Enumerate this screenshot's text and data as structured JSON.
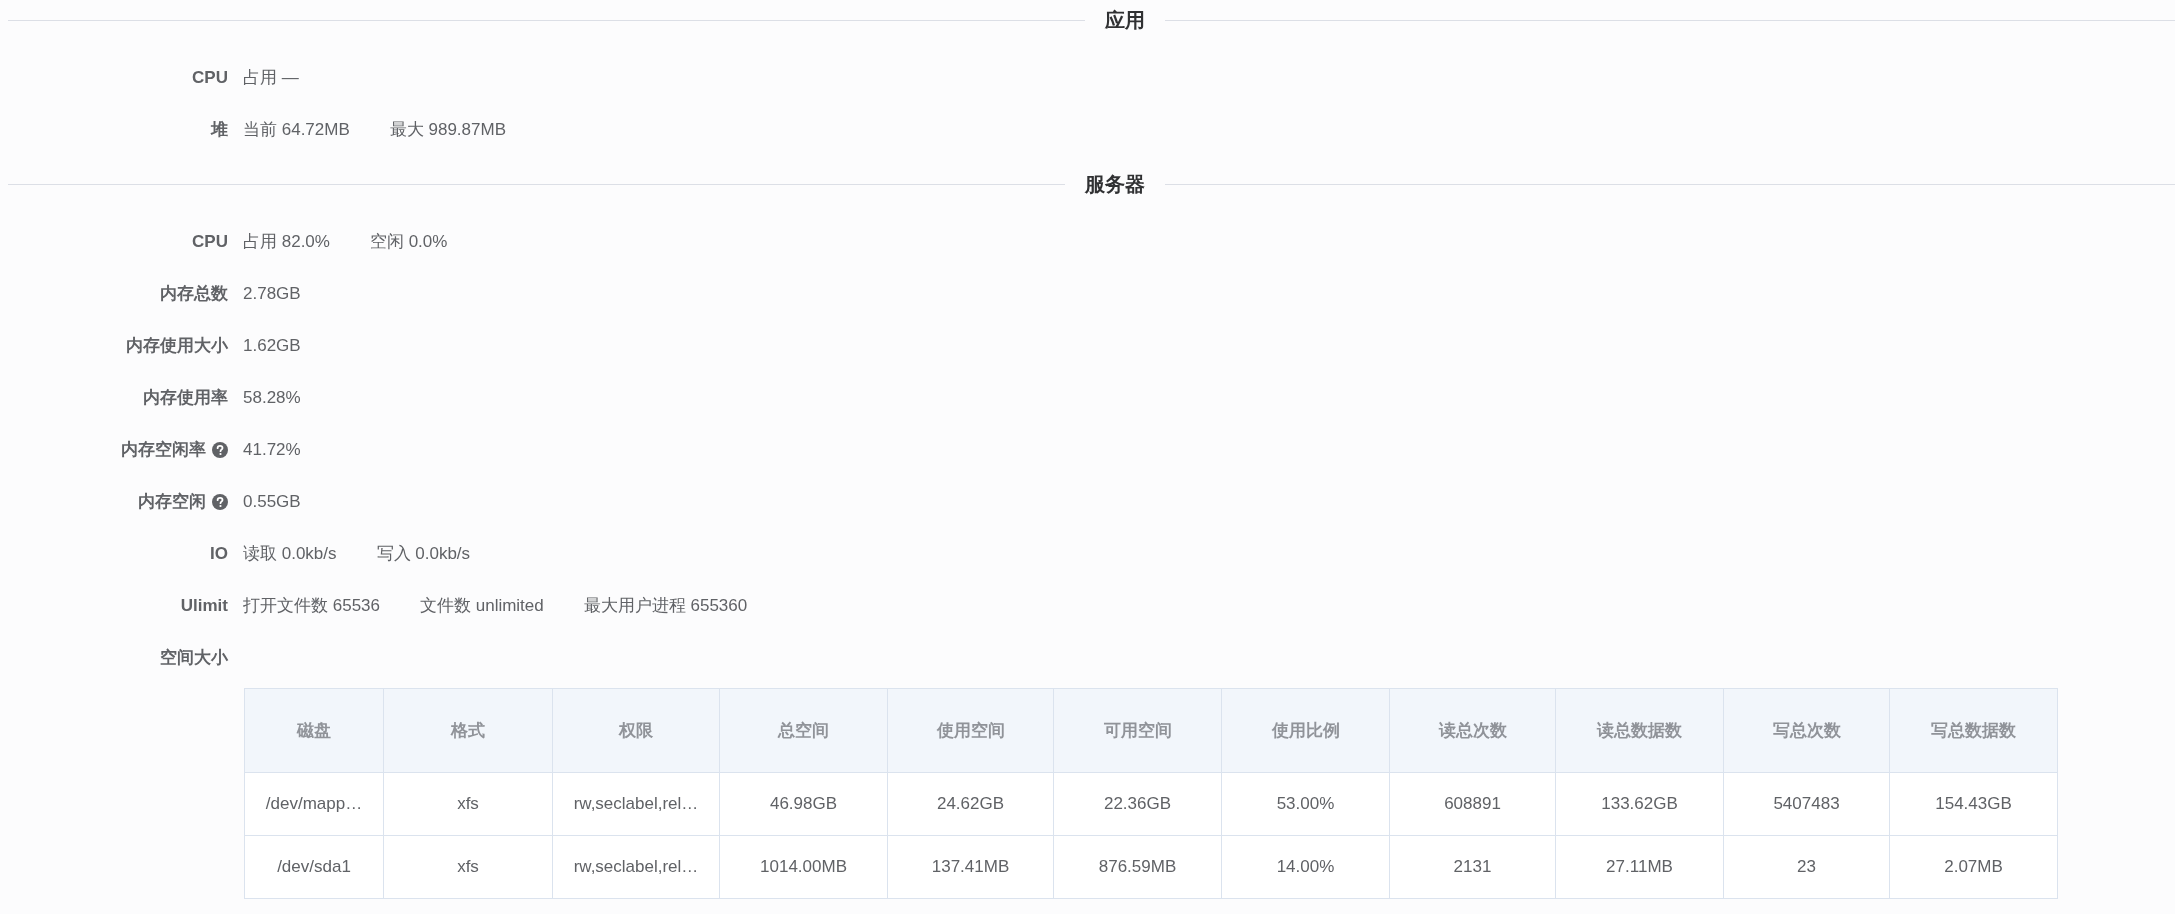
{
  "sections": [
    {
      "title": "应用",
      "rows": [
        {
          "label": "CPU",
          "help": false,
          "values": [
            "占用 —"
          ]
        },
        {
          "label": "堆",
          "help": false,
          "values": [
            "当前 64.72MB",
            "最大 989.87MB"
          ]
        }
      ]
    },
    {
      "title": "服务器",
      "rows": [
        {
          "label": "CPU",
          "help": false,
          "values": [
            "占用 82.0%",
            "空闲 0.0%"
          ]
        },
        {
          "label": "内存总数",
          "help": false,
          "values": [
            "2.78GB"
          ]
        },
        {
          "label": "内存使用大小",
          "help": false,
          "values": [
            "1.62GB"
          ]
        },
        {
          "label": "内存使用率",
          "help": false,
          "values": [
            "58.28%"
          ]
        },
        {
          "label": "内存空闲率",
          "help": true,
          "values": [
            "41.72%"
          ]
        },
        {
          "label": "内存空闲",
          "help": true,
          "values": [
            "0.55GB"
          ]
        },
        {
          "label": "IO",
          "help": false,
          "values": [
            "读取 0.0kb/s",
            "写入 0.0kb/s"
          ]
        },
        {
          "label": "Ulimit",
          "help": false,
          "values": [
            "打开文件数 65536",
            "文件数 unlimited",
            "最大用户进程 655360"
          ]
        },
        {
          "label": "空间大小",
          "help": false,
          "values": []
        }
      ]
    }
  ],
  "table": {
    "columns": [
      "磁盘",
      "格式",
      "权限",
      "总空间",
      "使用空间",
      "可用空间",
      "使用比例",
      "读总次数",
      "读总数据数",
      "写总次数",
      "写总数据数"
    ],
    "rows": [
      [
        "/dev/mapp…",
        "xfs",
        "rw,seclabel,rel…",
        "46.98GB",
        "24.62GB",
        "22.36GB",
        "53.00%",
        "608891",
        "133.62GB",
        "5407483",
        "154.43GB"
      ],
      [
        "/dev/sda1",
        "xfs",
        "rw,seclabel,rel…",
        "1014.00MB",
        "137.41MB",
        "876.59MB",
        "14.00%",
        "2131",
        "27.11MB",
        "23",
        "2.07MB"
      ]
    ]
  }
}
